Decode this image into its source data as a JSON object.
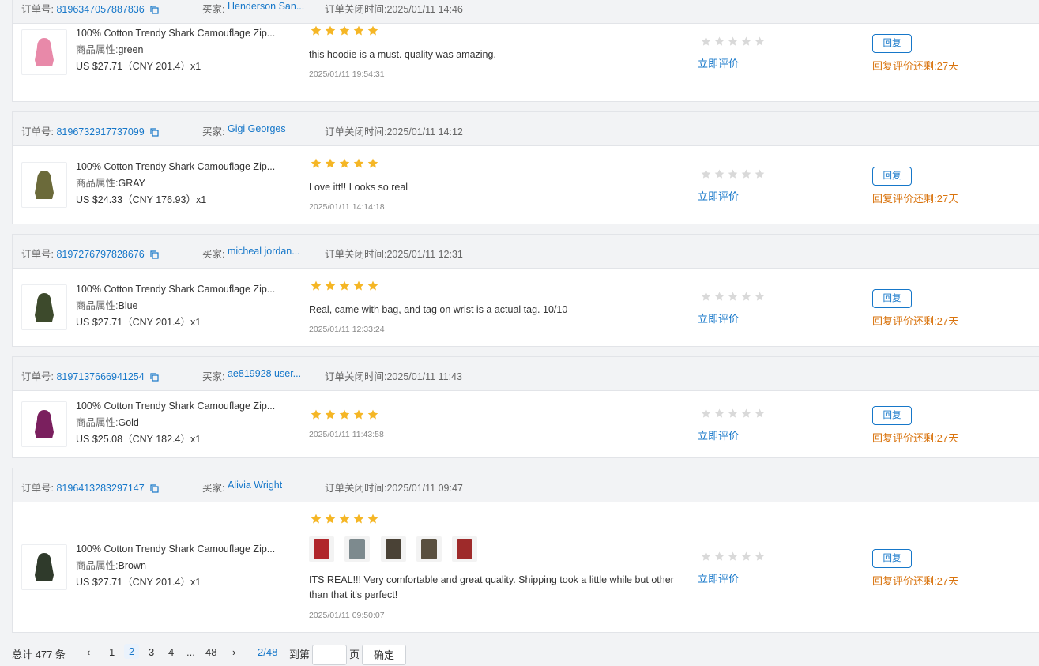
{
  "labels": {
    "order_no": "订单号:",
    "buyer": "买家:",
    "close_time": "订单关闭时间:",
    "attr": "商品属性:",
    "rate_now": "立即评价",
    "reply": "回复",
    "reply_left": "回复评价还剩:27天"
  },
  "colors": {
    "link": "#1677c9",
    "star": "#f5b625",
    "star_empty": "#d9d9d9",
    "warning": "#d9730d"
  },
  "orders": [
    {
      "order_no": "8196347057887836",
      "buyer": "Henderson San...",
      "close_time": "2025/01/11 14:46",
      "product": "100% Cotton Trendy Shark Camouflage Zip...",
      "attr": "green",
      "price": "US $27.71（CNY  201.4）x1",
      "rating": 5,
      "comment": "this hoodie is a must. quality was amazing.",
      "review_time": "2025/01/11 19:54:31",
      "thumb_color": "#e889a9"
    },
    {
      "order_no": "8196732917737099",
      "buyer": "Gigi Georges",
      "close_time": "2025/01/11 14:12",
      "product": "100% Cotton Trendy Shark Camouflage Zip...",
      "attr": "GRAY",
      "price": "US $24.33（CNY  176.93）x1",
      "rating": 5,
      "comment": "Love itt!! Looks so real",
      "review_time": "2025/01/11 14:14:18",
      "thumb_color": "#6b6a3a"
    },
    {
      "order_no": "8197276797828676",
      "buyer": "micheal jordan...",
      "close_time": "2025/01/11 12:31",
      "product": "100% Cotton Trendy Shark Camouflage Zip...",
      "attr": "Blue",
      "price": "US $27.71（CNY  201.4）x1",
      "rating": 5,
      "comment": "Real, came with bag, and tag on wrist is a actual tag. 10/10",
      "review_time": "2025/01/11 12:33:24",
      "thumb_color": "#3d4a2c"
    },
    {
      "order_no": "8197137666941254",
      "buyer": "ae819928 user...",
      "close_time": "2025/01/11 11:43",
      "product": "100% Cotton Trendy Shark Camouflage Zip...",
      "attr": "Gold",
      "price": "US $25.08（CNY  182.4）x1",
      "rating": 5,
      "comment": "",
      "review_time": "2025/01/11 11:43:58",
      "thumb_color": "#7a1f5e"
    },
    {
      "order_no": "8196413283297147",
      "buyer": "Alivia Wright",
      "close_time": "2025/01/11 09:47",
      "product": "100% Cotton Trendy Shark Camouflage Zip...",
      "attr": "Brown",
      "price": "US $27.71（CNY  201.4）x1",
      "rating": 5,
      "comment": "ITS REAL!!! Very comfortable and great quality. Shipping took a little while but other than that it's perfect!",
      "review_time": "2025/01/11 09:50:07",
      "thumb_color": "#2f3a2b",
      "photo_colors": [
        "#b0262b",
        "#7d8a8e",
        "#4a4236",
        "#5a5040",
        "#9e2a2a"
      ]
    }
  ],
  "pagination": {
    "total": "总计 477 条",
    "prev": "‹",
    "next": "›",
    "p1": "1",
    "p2": "2",
    "p3": "3",
    "p4": "4",
    "ellipsis": "...",
    "last": "48",
    "current": "2/48",
    "goto": "到第",
    "page_unit": "页",
    "confirm": "确定"
  }
}
